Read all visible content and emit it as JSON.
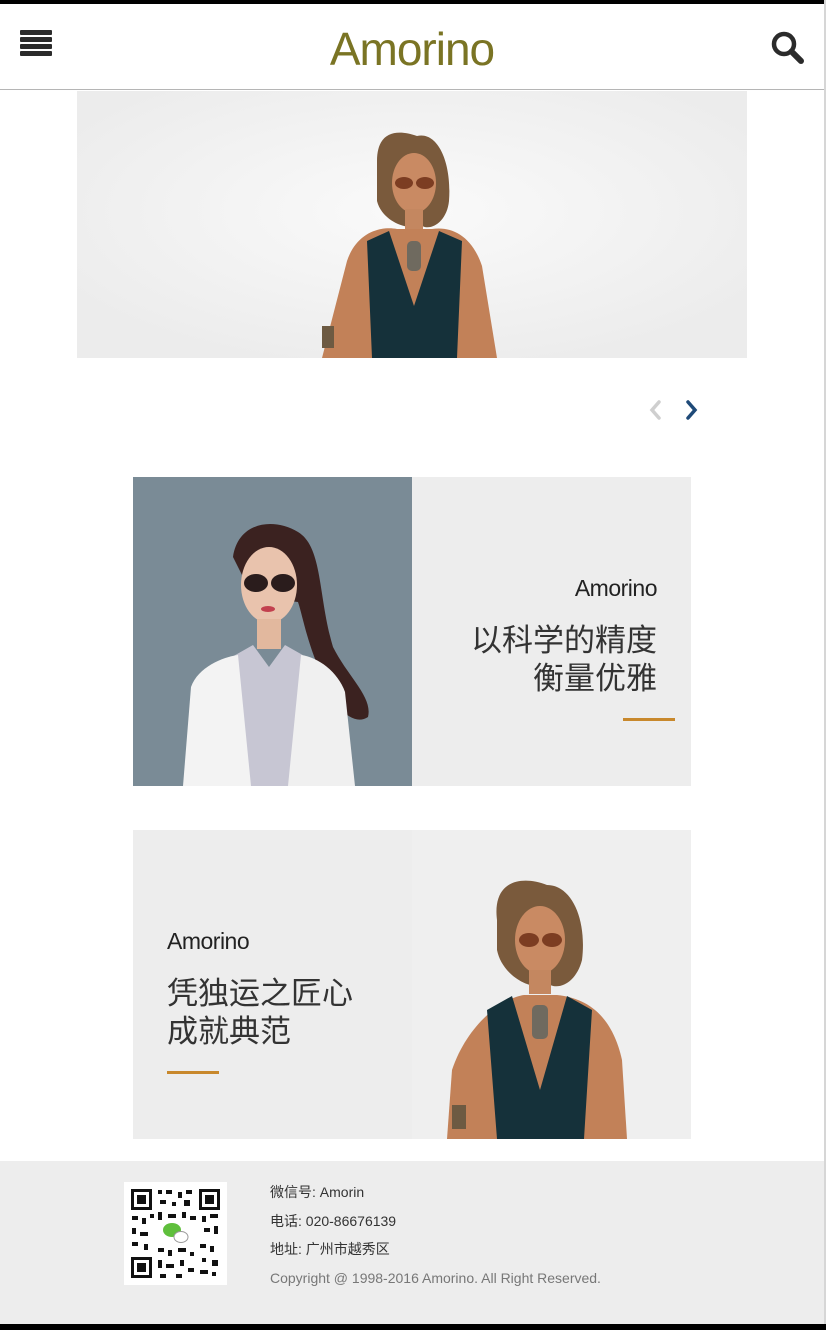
{
  "header": {
    "brand": "Amorino",
    "menu_icon": "hamburger-menu-icon",
    "search_icon": "search-icon"
  },
  "hero": {
    "slider": {
      "prev_icon": "chevron-left-icon",
      "next_icon": "chevron-right-icon"
    }
  },
  "features": [
    {
      "brand": "Amorino",
      "title_line1": "以科学的精度",
      "title_line2": "衡量优雅"
    },
    {
      "brand": "Amorino",
      "title_line1": "凭独运之匠心",
      "title_line2": "成就典范"
    }
  ],
  "footer": {
    "wechat": "微信号: Amorin",
    "phone": "电话: 020-86676139",
    "address": "地址: 广州市越秀区",
    "copyright": "Copyright @ 1998-2016 Amorino. All Right Reserved."
  },
  "colors": {
    "brand": "#7a7424",
    "accent": "#c8882c",
    "nav_active": "#1f4a78"
  }
}
